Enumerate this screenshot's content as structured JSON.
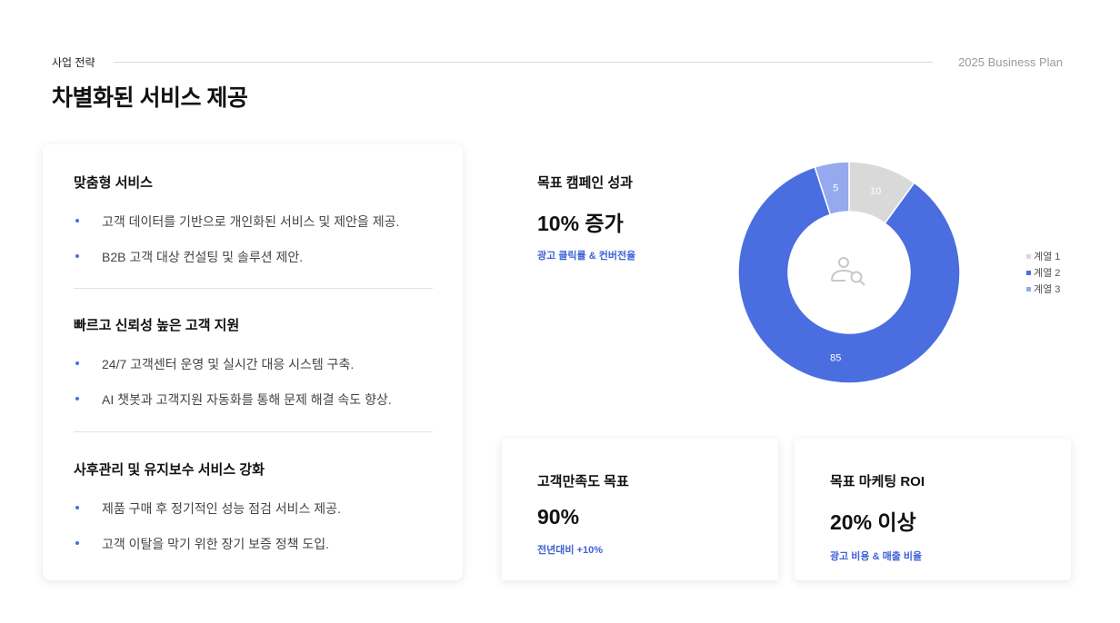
{
  "header": {
    "section_tag": "사업 전략",
    "plan_label": "2025 Business Plan",
    "title": "차별화된 서비스 제공"
  },
  "services": [
    {
      "title": "맞춤형 서비스",
      "bullets": [
        "고객 데이터를 기반으로 개인화된 서비스 및 제안을 제공.",
        "B2B 고객 대상 컨설팅 및 솔루션 제안."
      ]
    },
    {
      "title": "빠르고 신뢰성 높은 고객 지원",
      "bullets": [
        "24/7 고객센터 운영 및 실시간 대응 시스템 구축.",
        "AI 챗봇과 고객지원 자동화를 통해 문제 해결 속도 향상."
      ]
    },
    {
      "title": "사후관리 및 유지보수 서비스 강화",
      "bullets": [
        "제품 구매 후 정기적인 성능 점검 서비스 제공.",
        "고객 이탈을 막기 위한 장기 보증 정책 도입."
      ]
    }
  ],
  "campaign": {
    "label": "목표 캠페인 성과",
    "value": "10% 증가",
    "sub": "광고 클릭률 & 컨버전율"
  },
  "satisfaction": {
    "label": "고객만족도 목표",
    "value": "90%",
    "sub": "전년대비 +10%"
  },
  "roi": {
    "label": "목표 마케팅 ROI",
    "value": "20% 이상",
    "sub": "광고 비용 & 매출 비율"
  },
  "colors": {
    "accent": "#4a6ee0",
    "series1": "#d9d9d9",
    "series2": "#4a6ee0",
    "series3": "#94a9ee"
  },
  "chart_data": {
    "type": "pie",
    "categories": [
      "계열 1",
      "계열 2",
      "계열 3"
    ],
    "values": [
      10,
      85,
      5
    ],
    "legend": "right",
    "center_icon": "user-search-icon"
  }
}
